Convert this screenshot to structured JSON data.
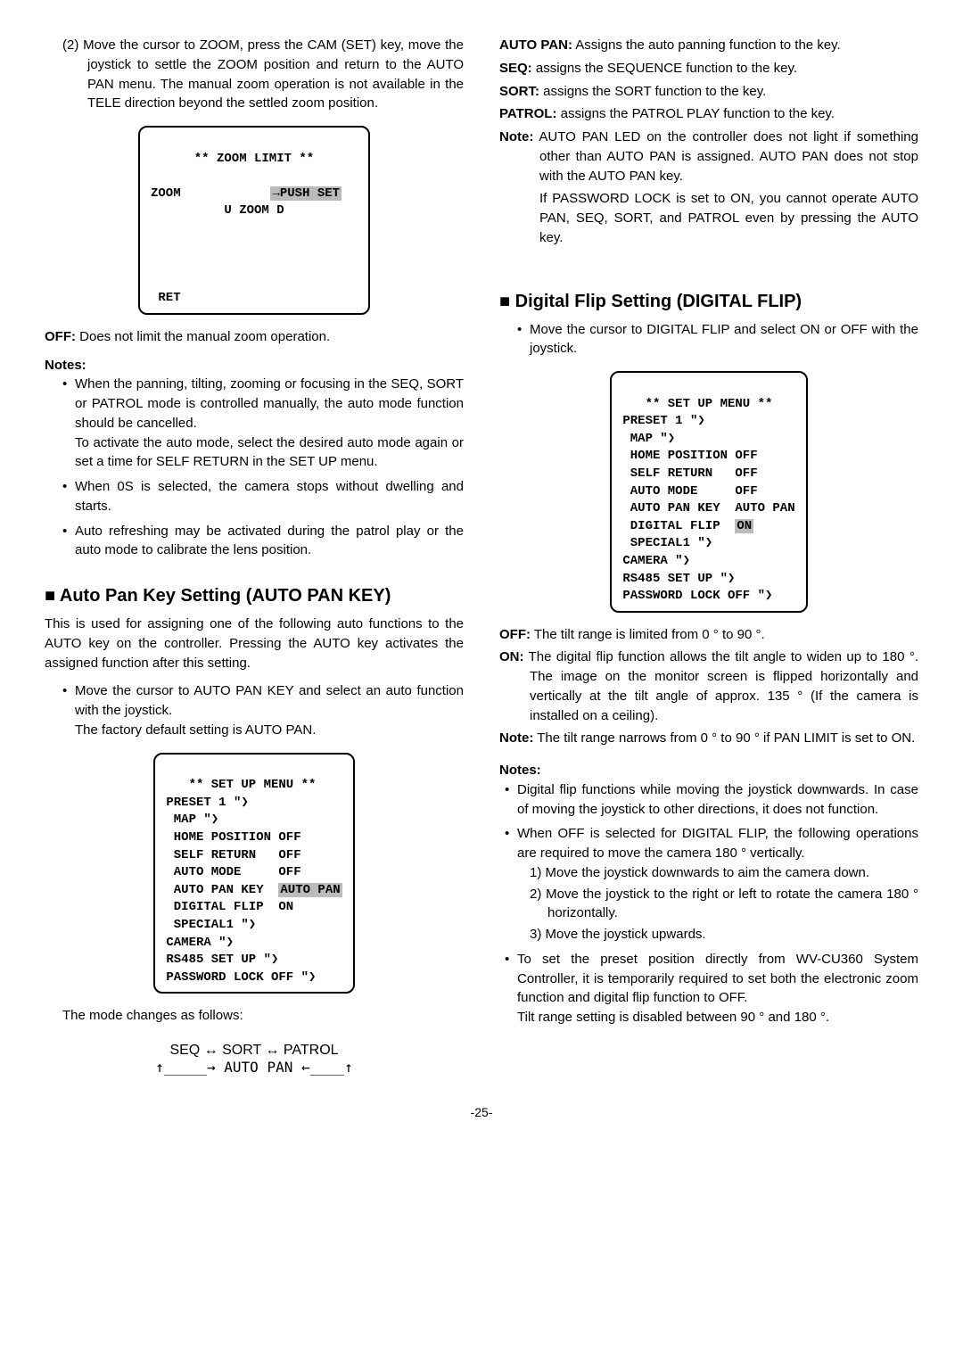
{
  "left": {
    "step2": "(2) Move the cursor to ZOOM, press the CAM (SET) key, move the joystick to settle the ZOOM position and return to the AUTO PAN menu. The manual zoom operation is not available in the TELE direction beyond the settled zoom position.",
    "zoom_box_title": "** ZOOM LIMIT **",
    "zoom_box_l1a": "ZOOM",
    "zoom_box_l1b": "→PUSH SET",
    "zoom_box_l2": "U ZOOM D",
    "zoom_box_ret": " RET",
    "off_line_label": "OFF:",
    "off_line_text": " Does not limit the manual zoom operation.",
    "notes_label": "Notes:",
    "note_b1": "When the panning, tilting, zooming or focusing in the SEQ, SORT or PATROL mode is controlled manually, the auto mode function should be cancelled.",
    "note_b1b": "To activate the auto mode, select the desired auto mode again or set a time for SELF RETURN in the SET UP menu.",
    "note_b2": "When 0S is selected, the camera stops without dwelling and starts.",
    "note_b3": "Auto refreshing may be activated during the patrol play or the auto mode to calibrate the lens position.",
    "h2_autopan": "■ Auto Pan Key Setting (AUTO PAN KEY)",
    "autopan_intro": "This is used for assigning one of the following auto functions to the AUTO key on the controller. Pressing the AUTO key activates the assigned function after this setting.",
    "autopan_b1": "Move the cursor to AUTO PAN KEY and select an auto function with the joystick.",
    "autopan_b1b": "The factory default setting is AUTO PAN.",
    "menu1_title": "   ** SET UP MENU **",
    "menu1_l1": "PRESET 1 \"❯",
    "menu1_l2": " MAP \"❯",
    "menu1_l3": " HOME POSITION OFF",
    "menu1_l4": " SELF RETURN   OFF",
    "menu1_l5": " AUTO MODE     OFF",
    "menu1_l6a": " AUTO PAN KEY  ",
    "menu1_l6b": "AUTO PAN",
    "menu1_l7": " DIGITAL FLIP  ON",
    "menu1_l8": " SPECIAL1 \"❯",
    "menu1_l9": "CAMERA \"❯",
    "menu1_l10": "RS485 SET UP \"❯",
    "menu1_l11": "PASSWORD LOCK OFF \"❯",
    "mode_changes": "The mode changes as follows:",
    "diag_top": "SEQ ↔ SORT ↔ PATROL",
    "diag_bot": "↑_____→ AUTO PAN ←____↑"
  },
  "right": {
    "def_autopan_l": "AUTO PAN:",
    "def_autopan_t": " Assigns the auto panning function to the key.",
    "def_seq_l": "SEQ:",
    "def_seq_t": " assigns the SEQUENCE function to the key.",
    "def_sort_l": "SORT:",
    "def_sort_t": " assigns the SORT function to the key.",
    "def_patrol_l": "PATROL:",
    "def_patrol_t": " assigns the PATROL PLAY function to the key.",
    "def_note_l": "Note:",
    "def_note_t": " AUTO PAN LED on the controller does not light if something other than AUTO PAN is assigned. AUTO PAN does not stop with the AUTO PAN key.",
    "def_note_t2": "If PASSWORD LOCK is set to ON, you cannot operate AUTO PAN, SEQ, SORT, and PATROL even by pressing the AUTO key.",
    "h2_flip": "■ Digital Flip Setting (DIGITAL FLIP)",
    "flip_b1": "Move the cursor to DIGITAL FLIP and select ON or OFF with the joystick.",
    "menu2_title": "   ** SET UP MENU **",
    "menu2_l1": "PRESET 1 \"❯",
    "menu2_l2": " MAP \"❯",
    "menu2_l3": " HOME POSITION OFF",
    "menu2_l4": " SELF RETURN   OFF",
    "menu2_l5": " AUTO MODE     OFF",
    "menu2_l6": " AUTO PAN KEY  AUTO PAN",
    "menu2_l7a": " DIGITAL FLIP  ",
    "menu2_l7b": "ON",
    "menu2_l8": " SPECIAL1 \"❯",
    "menu2_l9": "CAMERA \"❯",
    "menu2_l10": "RS485 SET UP \"❯",
    "menu2_l11": "PASSWORD LOCK OFF \"❯",
    "flip_off_l": "OFF:",
    "flip_off_t": " The tilt range is limited from 0 ° to 90 °.",
    "flip_on_l": "ON:",
    "flip_on_t": " The digital flip function allows the tilt angle to widen up to 180 °. The image on the monitor screen is flipped horizontally and vertically at the tilt angle of approx. 135 ° (If the camera is installed on a ceiling).",
    "flip_note_l": "Note:",
    "flip_note_t": " The tilt range narrows from 0 ° to 90 ° if PAN LIMIT is set to ON.",
    "notes2_label": "Notes:",
    "n2_b1": "Digital flip functions while moving the joystick downwards. In case of moving the joystick to other directions, it does not function.",
    "n2_b2": "When OFF is selected for DIGITAL FLIP, the following operations are required to move the camera 180 ° vertically.",
    "n2_b2_1": "1) Move the joystick downwards to aim the camera down.",
    "n2_b2_2": "2) Move the joystick to the right or left to rotate the camera 180 ° horizontally.",
    "n2_b2_3": "3) Move the joystick upwards.",
    "n2_b3": "To set the preset position directly from WV-CU360 System Controller, it is temporarily required to set both the electronic zoom function and digital flip function to OFF.",
    "n2_b3b": "Tilt range setting is disabled between 90 ° and 180 °."
  },
  "page": "-25-"
}
